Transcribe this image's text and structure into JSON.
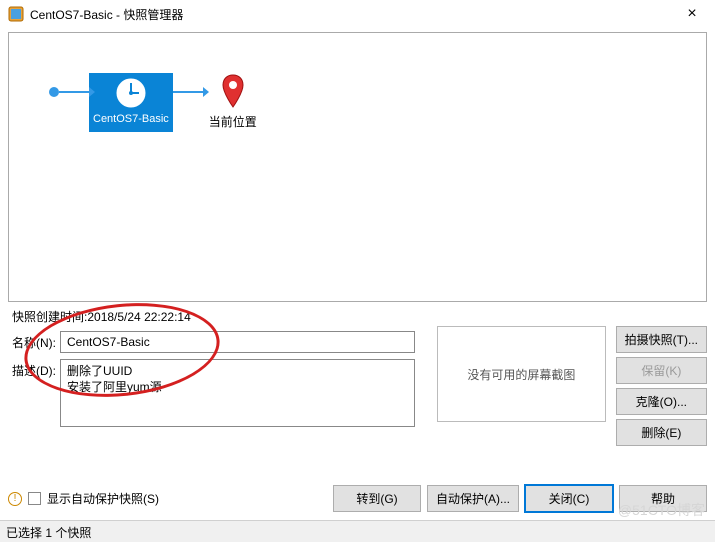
{
  "window": {
    "title": "CentOS7-Basic - 快照管理器",
    "close": "×"
  },
  "flow": {
    "snapshot_name": "CentOS7-Basic",
    "current_location": "当前位置"
  },
  "details": {
    "created_label": "快照创建时间:",
    "created_value": "2018/5/24 22:22:14",
    "name_label": "名称(N):",
    "name_value": "CentOS7-Basic",
    "desc_label": "描述(D):",
    "desc_value": "删除了UUID\n安装了阿里yum源",
    "no_screenshot": "没有可用的屏幕截图"
  },
  "buttons": {
    "take_snapshot": "拍摄快照(T)...",
    "keep": "保留(K)",
    "clone": "克隆(O)...",
    "delete": "删除(E)",
    "goto": "转到(G)",
    "auto_protect": "自动保护(A)...",
    "close": "关闭(C)",
    "help": "帮助"
  },
  "checkbox": {
    "label": "显示自动保护快照(S)"
  },
  "status": "已选择 1 个快照",
  "watermark": "@51CTO博客"
}
